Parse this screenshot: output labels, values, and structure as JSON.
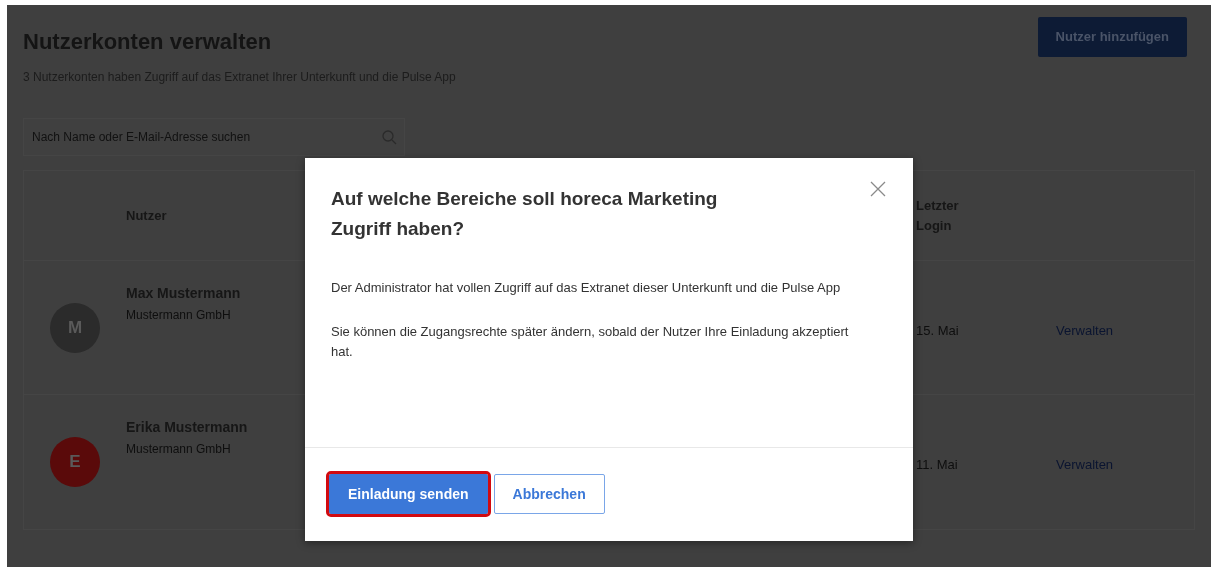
{
  "page": {
    "title": "Nutzerkonten verwalten",
    "subtitle": "3 Nutzerkonten haben Zugriff auf das Extranet Ihrer Unterkunft und die Pulse App",
    "add_button": "Nutzer hinzufügen"
  },
  "search": {
    "placeholder": "Nach Name oder E-Mail-Adresse suchen"
  },
  "table": {
    "columns": [
      "Nutzer",
      "Letzter Login"
    ],
    "rows": [
      {
        "initial": "M",
        "color": "#2b2b2b",
        "name": "Max Mustermann",
        "company": "Mustermann GmbH",
        "last_login": "15. Mai",
        "action": "Verwalten"
      },
      {
        "initial": "E",
        "color": "#5a0a0a",
        "name": "Erika Mustermann",
        "company": "Mustermann GmbH",
        "last_login": "11. Mai",
        "action": "Verwalten"
      }
    ]
  },
  "dialog": {
    "title": "Auf welche Bereiche soll horeca Marketing Zugriff haben?",
    "paragraphs": [
      "Der Administrator hat vollen Zugriff auf das Extranet dieser Unterkunft und die Pulse App",
      "Sie können die Zugangsrechte später ändern, sobald der Nutzer Ihre Einladung akzeptiert hat."
    ],
    "buttons": [
      {
        "label": "Einladung senden",
        "kind": "primary",
        "highlighted": true
      },
      {
        "label": "Abbrechen",
        "kind": "secondary",
        "highlighted": false
      }
    ]
  }
}
